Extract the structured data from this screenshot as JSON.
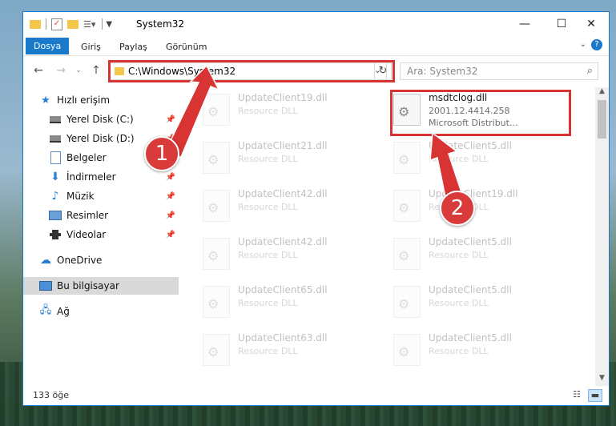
{
  "window": {
    "title": "System32",
    "controls": {
      "minimize": "—",
      "maximize": "☐",
      "close": "✕"
    }
  },
  "ribbon": {
    "tabs": [
      {
        "label": "Dosya",
        "active": true
      },
      {
        "label": "Giriş",
        "active": false
      },
      {
        "label": "Paylaş",
        "active": false
      },
      {
        "label": "Görünüm",
        "active": false
      }
    ]
  },
  "address": {
    "path": "C:\\Windows\\System32",
    "search_placeholder": "Ara: System32"
  },
  "sidebar": {
    "items": [
      {
        "label": "Hızlı erişim",
        "icon": "star-icon"
      },
      {
        "label": "Yerel Disk (C:)",
        "icon": "drive-icon"
      },
      {
        "label": "Yerel Disk (D:)",
        "icon": "drive-icon"
      },
      {
        "label": "Belgeler",
        "icon": "documents-icon"
      },
      {
        "label": "İndirmeler",
        "icon": "download-icon"
      },
      {
        "label": "Müzik",
        "icon": "music-icon"
      },
      {
        "label": "Resimler",
        "icon": "pictures-icon"
      },
      {
        "label": "Videolar",
        "icon": "videos-icon"
      },
      {
        "label": "OneDrive",
        "icon": "cloud-icon"
      },
      {
        "label": "Bu bilgisayar",
        "icon": "computer-icon"
      },
      {
        "label": "Ağ",
        "icon": "network-icon"
      }
    ]
  },
  "files": {
    "highlight": {
      "name": "msdtclog.dll",
      "version": "2001.12.4414.258",
      "company": "Microsoft Distribut..."
    },
    "items": [
      {
        "name": "UpdateClient19.dll",
        "type": "Resource DLL"
      },
      {
        "name": "UpdateClient21.dll",
        "type": "Resource DLL"
      },
      {
        "name": "UpdateClient5.dll",
        "type": "Resource DLL"
      },
      {
        "name": "UpdateClient42.dll",
        "type": "Resource DLL"
      },
      {
        "name": "UpdateClient19.dll",
        "type": "Resource DLL"
      },
      {
        "name": "UpdateClient42.dll",
        "type": "Resource DLL"
      },
      {
        "name": "UpdateClient5.dll",
        "type": "Resource DLL"
      },
      {
        "name": "UpdateClient65.dll",
        "type": "Resource DLL"
      },
      {
        "name": "UpdateClient5.dll",
        "type": "Resource DLL"
      },
      {
        "name": "UpdateClient63.dll",
        "type": "Resource DLL"
      },
      {
        "name": "UpdateClient5.dll",
        "type": "Resource DLL"
      }
    ]
  },
  "status": {
    "count": "133 öğe"
  },
  "annotations": {
    "badge1": "1",
    "badge2": "2",
    "color": "#d93434"
  }
}
